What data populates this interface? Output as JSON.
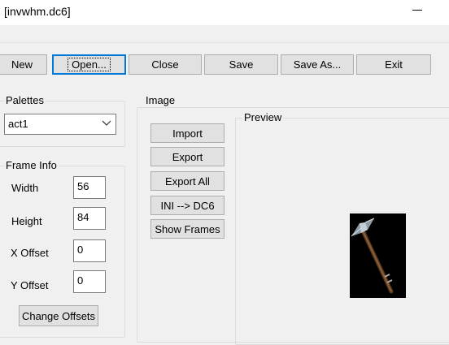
{
  "window": {
    "title": "[invwhm.dc6]"
  },
  "toolbar": {
    "new_label": "New",
    "open_label": "Open...",
    "close_label": "Close",
    "save_label": "Save",
    "save_as_label": "Save As...",
    "exit_label": "Exit"
  },
  "palettes": {
    "legend": "Palettes",
    "selected": "act1"
  },
  "frame_info": {
    "legend": "Frame Info",
    "width_label": "Width",
    "width_value": "56",
    "height_label": "Height",
    "height_value": "84",
    "x_offset_label": "X Offset",
    "x_offset_value": "0",
    "y_offset_label": "Y Offset",
    "y_offset_value": "0",
    "change_offsets_label": "Change Offsets"
  },
  "image": {
    "legend": "Image",
    "import_label": "Import",
    "export_label": "Export",
    "export_all_label": "Export All",
    "ini_dc6_label": "INI --> DC6",
    "show_frames_label": "Show Frames",
    "preview_legend": "Preview"
  },
  "icons": {
    "minimize": "minimize-icon",
    "dropdown": "chevron-down-icon",
    "preview_item": "war-hammer-sprite"
  },
  "colors": {
    "focus_border": "#0078d7",
    "preview_background": "#000000"
  }
}
